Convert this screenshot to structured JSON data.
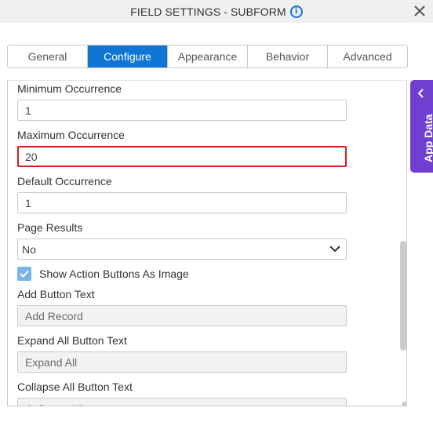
{
  "header": {
    "title": "FIELD SETTINGS - SUBFORM",
    "info_icon": "info-circle-icon",
    "close_icon": "close-icon"
  },
  "tabs": [
    {
      "label": "General",
      "active": false
    },
    {
      "label": "Configure",
      "active": true
    },
    {
      "label": "Appearance",
      "active": false
    },
    {
      "label": "Behavior",
      "active": false
    },
    {
      "label": "Advanced",
      "active": false
    }
  ],
  "fields": {
    "minimum_occurrence": {
      "label": "Minimum Occurrence",
      "value": "1"
    },
    "maximum_occurrence": {
      "label": "Maximum Occurrence",
      "value": "20",
      "state": "error"
    },
    "default_occurrence": {
      "label": "Default Occurrence",
      "value": "1"
    },
    "page_results": {
      "label": "Page Results",
      "value": "No"
    },
    "show_action_buttons": {
      "label": "Show Action Buttons As Image",
      "checked": true
    },
    "add_button_text": {
      "label": "Add Button Text",
      "value": "Add Record",
      "disabled": true
    },
    "expand_all_button_text": {
      "label": "Expand All Button Text",
      "value": "Expand All",
      "disabled": true
    },
    "collapse_all_button_text": {
      "label": "Collapse All Button Text",
      "value": "Collapse All",
      "disabled": true
    }
  },
  "side_panel": {
    "label": "App Data",
    "icon": "chevron-left-icon"
  },
  "colors": {
    "accent": "#0f76d6",
    "error": "#d71d1d",
    "app_data": "#6e3fd1",
    "checkbox": "#79b4e8"
  }
}
